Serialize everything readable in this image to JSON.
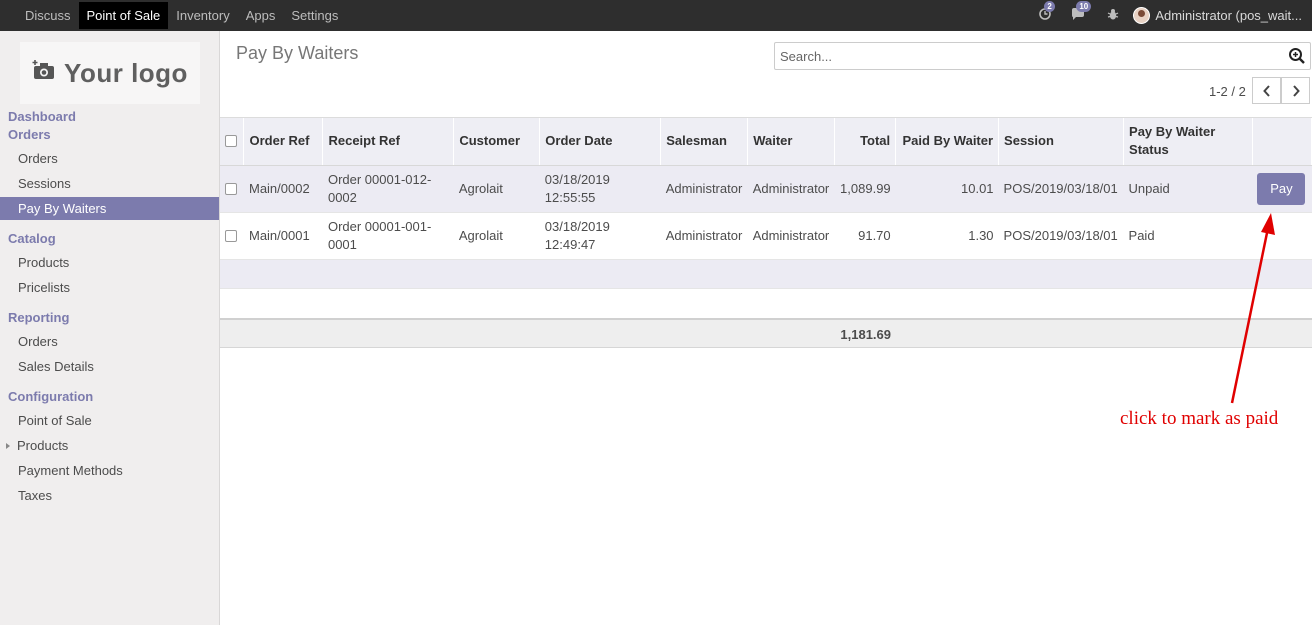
{
  "topbar": {
    "menu": [
      "Discuss",
      "Point of Sale",
      "Inventory",
      "Apps",
      "Settings"
    ],
    "active": "Point of Sale",
    "activity_badge": "2",
    "message_badge": "10",
    "user": "Administrator (pos_wait..."
  },
  "sidebar": {
    "logo": "Your logo",
    "dashboard": "Dashboard",
    "sections": [
      {
        "title": "Orders",
        "items": [
          "Orders",
          "Sessions",
          "Pay By Waiters"
        ]
      },
      {
        "title": "Catalog",
        "items": [
          "Products",
          "Pricelists"
        ]
      },
      {
        "title": "Reporting",
        "items": [
          "Orders",
          "Sales Details"
        ]
      },
      {
        "title": "Configuration",
        "items": [
          "Point of Sale",
          "Products",
          "Payment Methods",
          "Taxes"
        ]
      }
    ],
    "active_item": "Pay By Waiters"
  },
  "control_panel": {
    "title": "Pay By Waiters",
    "search_placeholder": "Search...",
    "pager": "1-2 / 2"
  },
  "table": {
    "columns": [
      "Order Ref",
      "Receipt Ref",
      "Customer",
      "Order Date",
      "Salesman",
      "Waiter",
      "Total",
      "Paid By Waiter",
      "Session",
      "Pay By Waiter Status"
    ],
    "rows": [
      {
        "order_ref": "Main/0002",
        "receipt_ref": "Order 00001-012-0002",
        "customer": "Agrolait",
        "order_date": "03/18/2019 12:55:55",
        "salesman": "Administrator",
        "waiter": "Administrator",
        "total": "1,089.99",
        "paid_by_waiter": "10.01",
        "session": "POS/2019/03/18/01",
        "status": "Unpaid",
        "action": "Pay"
      },
      {
        "order_ref": "Main/0001",
        "receipt_ref": "Order 00001-001-0001",
        "customer": "Agrolait",
        "order_date": "03/18/2019 12:49:47",
        "salesman": "Administrator",
        "waiter": "Administrator",
        "total": "91.70",
        "paid_by_waiter": "1.30",
        "session": "POS/2019/03/18/01",
        "status": "Paid",
        "action": ""
      }
    ],
    "footer_total": "1,181.69"
  },
  "annotation": {
    "text": "click to mark as paid",
    "color": "#e00000"
  },
  "colors": {
    "accent": "#7c7bad",
    "topbar": "#2e2e2e"
  }
}
